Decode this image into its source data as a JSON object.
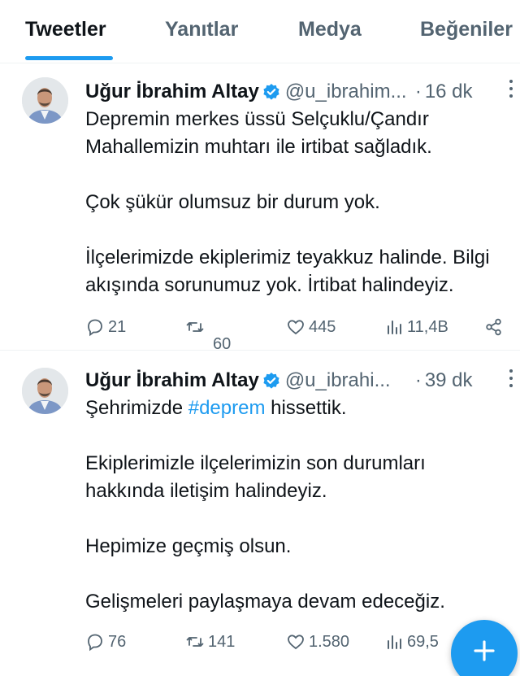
{
  "tabs": [
    {
      "label": "Tweetler",
      "active": true
    },
    {
      "label": "Yanıtlar",
      "active": false
    },
    {
      "label": "Medya",
      "active": false
    },
    {
      "label": "Beğeniler",
      "active": false
    }
  ],
  "colors": {
    "accent": "#1d9bf0",
    "text": "#0f1419",
    "muted": "#536471"
  },
  "tweets": [
    {
      "name": "Uğur İbrahim Altay",
      "handle": "@u_ibrahim...",
      "time": "16 dk",
      "lines": [
        "Depremin merkes üssü Selçuklu/Çandır",
        "Mahallemizin muhtarı ile irtibat sağladık.",
        "",
        "Çok şükür olumsuz bir durum yok.",
        "",
        "İlçelerimizde ekiplerimiz teyakkuz halinde. Bilgi",
        "akışında sorunumuz yok.  İrtibat halindeyiz."
      ],
      "replies": "21",
      "retweets": "60",
      "likes": "445",
      "views": "11,4B"
    },
    {
      "name": "Uğur İbrahim Altay",
      "handle": "@u_ibrahi...",
      "time": "39 dk",
      "text_before_hashtag": "Şehrimizde ",
      "hashtag": "#deprem",
      "text_after_hashtag": " hissettik.",
      "lines": [
        "",
        "Ekiplerimizle ilçelerimizin son durumları",
        "hakkında iletişim halindeyiz.",
        "",
        "Hepimize geçmiş olsun.",
        "",
        "Gelişmeleri paylaşmaya devam edeceğiz."
      ],
      "replies": "76",
      "retweets": "141",
      "likes": "1.580",
      "views": "69,5"
    }
  ],
  "icons": {
    "verified": "verified-badge-icon",
    "more": "more-dots-icon",
    "reply": "reply-bubble-icon",
    "retweet": "retweet-icon",
    "like": "heart-icon",
    "views": "views-bars-icon",
    "share": "share-icon",
    "compose": "plus-icon"
  }
}
